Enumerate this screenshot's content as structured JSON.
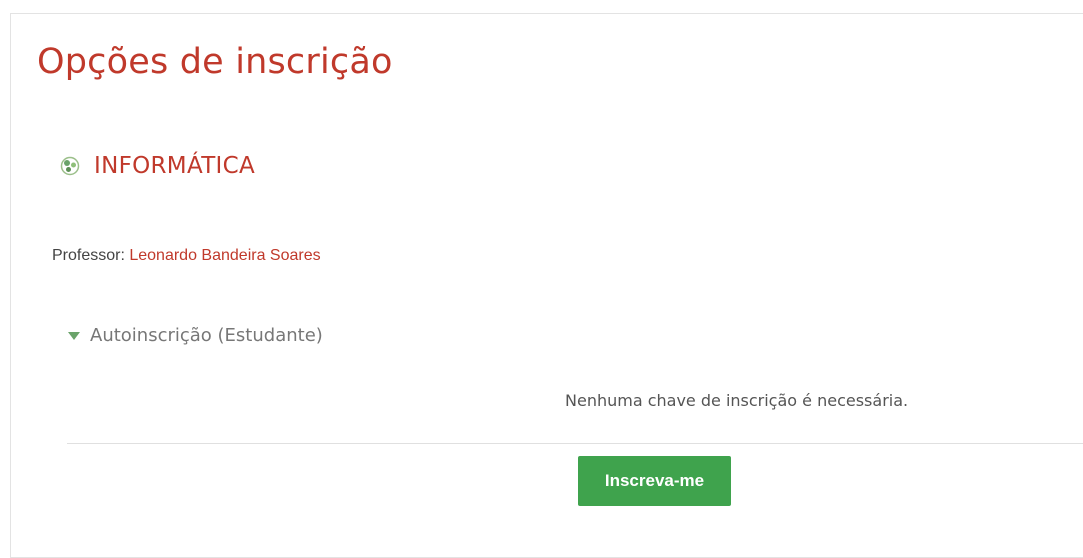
{
  "page": {
    "title": "Opções de inscrição"
  },
  "course": {
    "name": "INFORMÁTICA",
    "icon": "course-icon"
  },
  "teacher": {
    "label": "Professor: ",
    "name": "Leonardo Bandeira Soares"
  },
  "enrolment": {
    "section_label": "Autoinscrição (Estudante)",
    "message": "Nenhuma chave de inscrição é necessária.",
    "button_label": "Inscreva-me"
  },
  "colors": {
    "accent": "#c0392b",
    "button": "#3fa34d",
    "toggle": "#6aa36a"
  }
}
